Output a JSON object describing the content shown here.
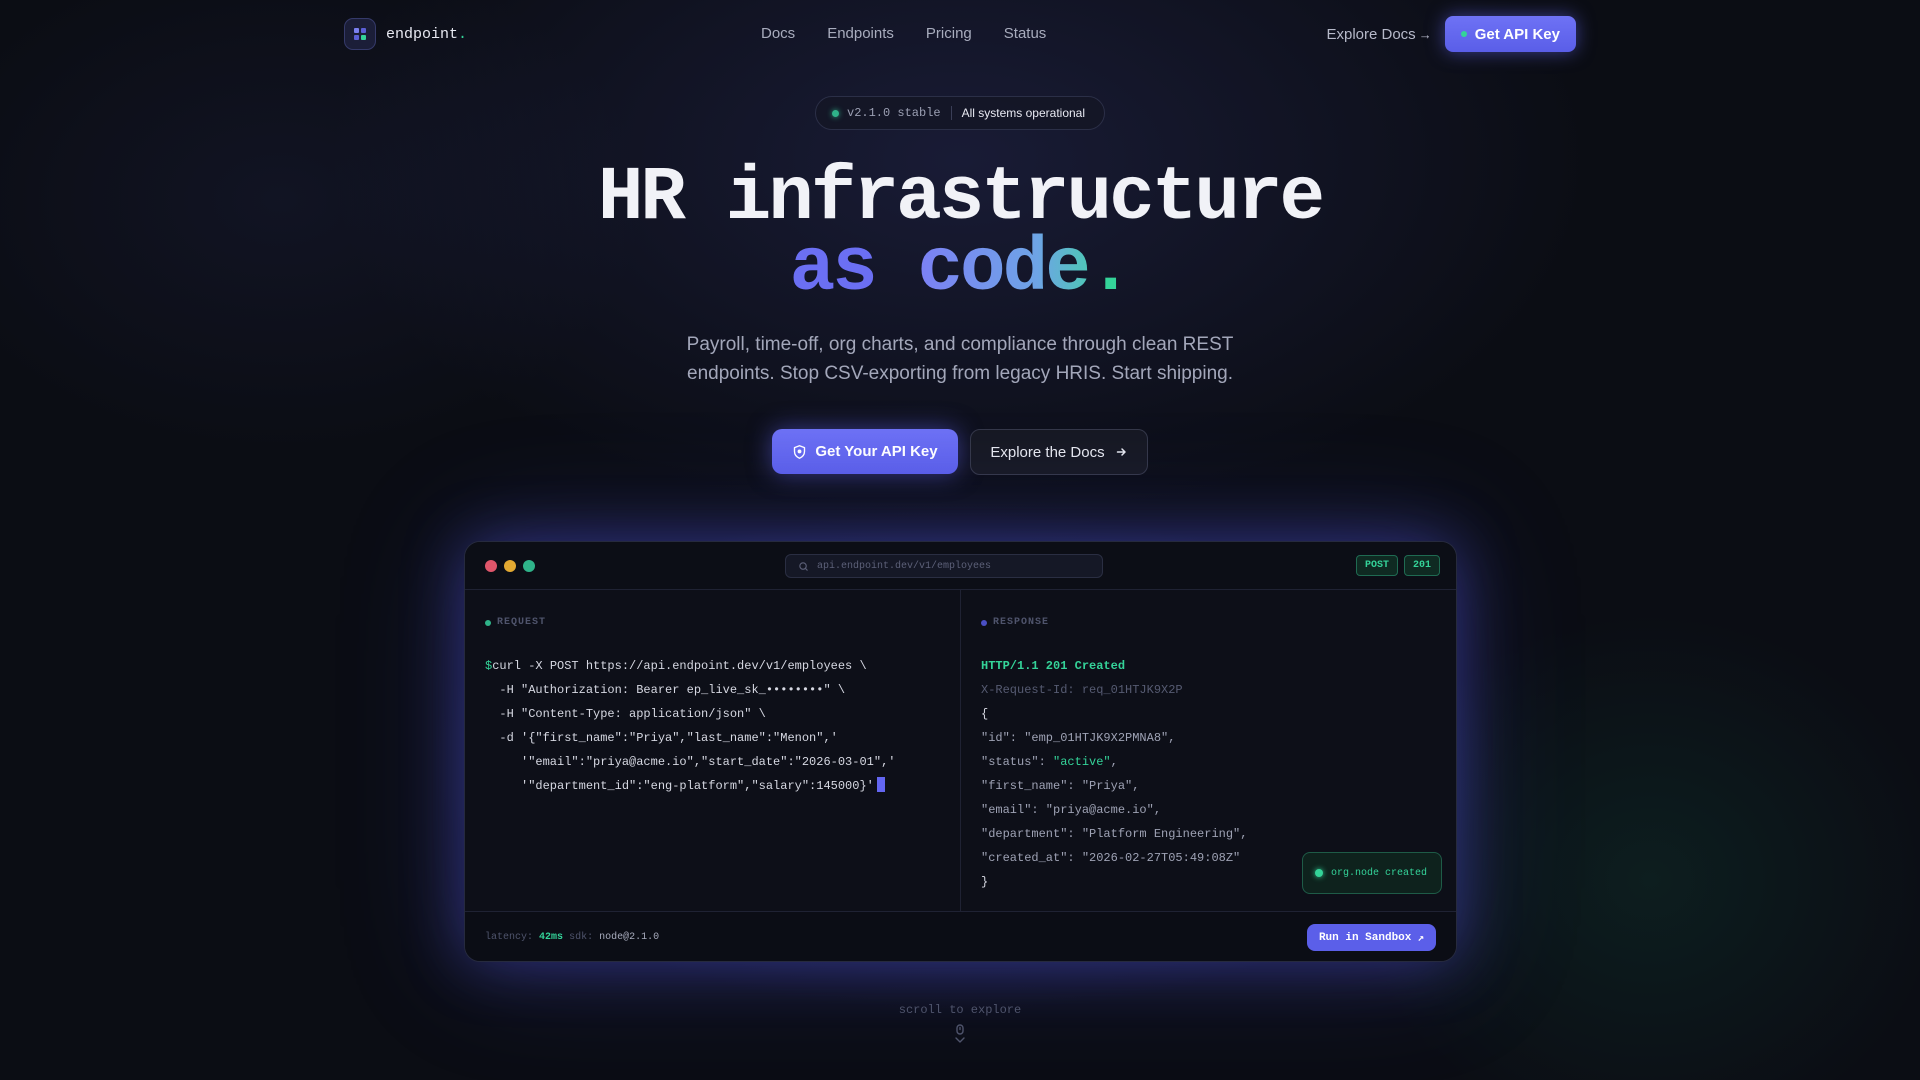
{
  "brand": {
    "name": "endpoint",
    "dot": "."
  },
  "nav": {
    "links": [
      "Docs",
      "Endpoints",
      "Pricing",
      "Status"
    ],
    "explore_label": "Explore Docs",
    "explore_arrow": "→",
    "api_key_label": "Get API Key"
  },
  "status_pill": {
    "version": "v2.1.0 stable",
    "message": "All systems operational"
  },
  "hero": {
    "line1": "HR infrastructure",
    "line2_word1": "as",
    "line2_word2": "code",
    "line2_punct": ".",
    "subtitle_line1": "Payroll, time-off, org charts, and compliance through clean REST",
    "subtitle_line2": "endpoints. Stop CSV-exporting from legacy HRIS. Start shipping."
  },
  "cta": {
    "primary_label": "Get Your API Key",
    "secondary_label": "Explore the Docs"
  },
  "terminal": {
    "url": "api.endpoint.dev/v1/employees",
    "method_badge": "POST",
    "status_badge": "201",
    "request_label": "REQUEST",
    "response_label": "RESPONSE",
    "request_lines": {
      "prompt": "$",
      "l1": "curl -X POST https://api.endpoint.dev/v1/employees \\",
      "l2": "  -H \"Authorization: Bearer ep_live_sk_••••••••\" \\",
      "l3": "  -H \"Content-Type: application/json\" \\",
      "l4": "  -d '{\"first_name\":\"Priya\",\"last_name\":\"Menon\",'",
      "l5": "     '\"email\":\"priya@acme.io\",\"start_date\":\"2026-03-01\",'",
      "l6": "     '\"department_id\":\"eng-platform\",\"salary\":145000}'"
    },
    "response_lines": {
      "status": "HTTP/1.1 201 Created",
      "request_id": "X-Request-Id: req_01HTJK9X2P",
      "open": "{",
      "id": "\"id\": \"emp_01HTJK9X2PMNA8\",",
      "status_key": "\"status\": ",
      "status_val": "\"active\"",
      "status_comma": ",",
      "first_name": "\"first_name\": \"Priya\",",
      "email": "\"email\": \"priya@acme.io\",",
      "department": "\"department\": \"Platform Engineering\",",
      "created_at": "\"created_at\": \"2026-02-27T05:49:08Z\"",
      "close": "}"
    },
    "toast": "org.node created",
    "footer": {
      "latency_label": "latency:",
      "latency_value": "42ms",
      "sdk_label": "sdk:",
      "sdk_value": "node@2.1.0",
      "sandbox_label": "Run in Sandbox",
      "sandbox_arrow": "↗"
    }
  },
  "scroll_hint": "scroll to explore",
  "colors": {
    "accent": "#6366f1",
    "success": "#34d399",
    "background": "#0b0d14"
  }
}
